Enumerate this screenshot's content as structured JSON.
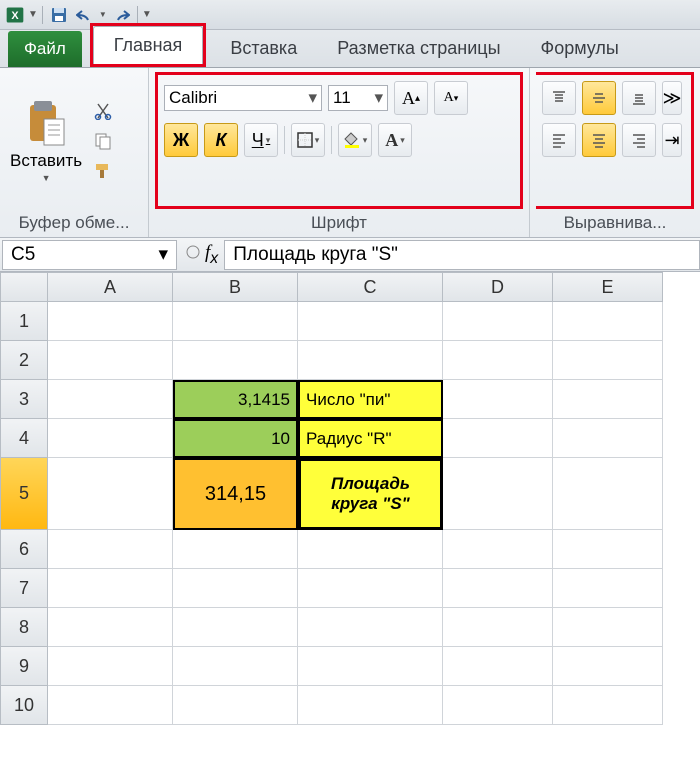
{
  "qat": {
    "save": "",
    "undo": "",
    "redo": ""
  },
  "tabs": {
    "file": "Файл",
    "items": [
      "Главная",
      "Вставка",
      "Разметка страницы",
      "Формулы"
    ],
    "active": 0
  },
  "ribbon": {
    "clipboard": {
      "paste": "Вставить",
      "label": "Буфер обме..."
    },
    "font": {
      "name": "Calibri",
      "size": "11",
      "bold": "Ж",
      "italic": "К",
      "underline": "Ч",
      "label": "Шрифт"
    },
    "align": {
      "label": "Выравнива..."
    }
  },
  "namebox": "C5",
  "formula": "Площадь круга \"S\"",
  "columns": [
    "A",
    "B",
    "C",
    "D",
    "E"
  ],
  "rows": [
    "1",
    "2",
    "3",
    "4",
    "5",
    "6",
    "7",
    "8",
    "9",
    "10"
  ],
  "cells": {
    "B3": "3,1415",
    "C3": "Число \"пи\"",
    "B4": "10",
    "C4": "Радиус \"R\"",
    "B5": "314,15",
    "C5": "Площадь круга \"S\""
  }
}
